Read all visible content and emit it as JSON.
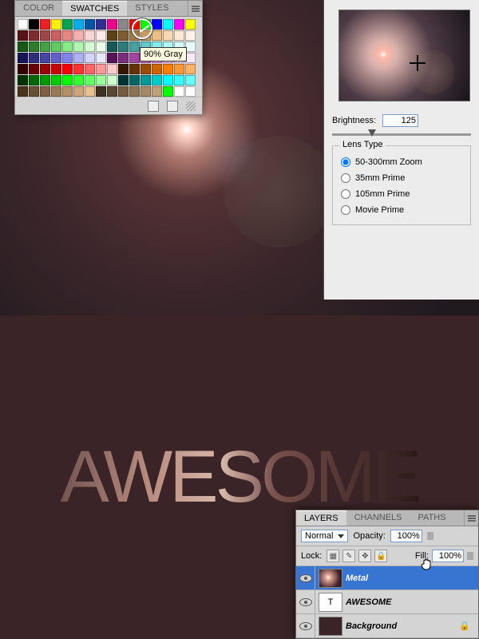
{
  "swatches_panel": {
    "tabs": [
      "COLOR",
      "SWATCHES",
      "STYLES"
    ],
    "active_tab": 1,
    "tooltip": "90% Gray",
    "colors": [
      "#ffffff",
      "#000000",
      "#ed2024",
      "#fff200",
      "#00a551",
      "#00aeef",
      "#0054a6",
      "#2e3092",
      "#ec008c",
      "#898989",
      "#ff0000",
      "#00ff00",
      "#0000ff",
      "#00ffff",
      "#ff00ff",
      "#ffff00",
      "#581414",
      "#7b2e2e",
      "#a04646",
      "#c96161",
      "#ed8484",
      "#f7b0b0",
      "#fcd5d5",
      "#fde9e9",
      "#5b4114",
      "#7e5e2e",
      "#a27c46",
      "#c99c61",
      "#edbd84",
      "#f7d8b0",
      "#fce9d5",
      "#fdf3e9",
      "#145814",
      "#2e7b2e",
      "#46a046",
      "#61c961",
      "#84ed84",
      "#b0f7b0",
      "#d5fcd5",
      "#e9fde9",
      "#145858",
      "#2e7b7b",
      "#46a0a0",
      "#61c9c9",
      "#84eded",
      "#b0f7f7",
      "#d5fcfc",
      "#e9fdfd",
      "#141458",
      "#2e2e7b",
      "#4646a0",
      "#6161c9",
      "#8484ed",
      "#b0b0f7",
      "#d5d5fc",
      "#e9e9fd",
      "#581458",
      "#7b2e7b",
      "#a046a0",
      "#c961c9",
      "#ed84ed",
      "#f7b0f7",
      "#fcd5fc",
      "#fde9fd",
      "#330000",
      "#660000",
      "#990000",
      "#cc0000",
      "#ff0000",
      "#ff3333",
      "#ff6666",
      "#ff9999",
      "#ffcccc",
      "#331900",
      "#663300",
      "#994c00",
      "#cc6600",
      "#ff8000",
      "#ff9933",
      "#ffb366",
      "#003300",
      "#006600",
      "#009900",
      "#00cc00",
      "#00ff00",
      "#33ff33",
      "#66ff66",
      "#99ff99",
      "#ccffcc",
      "#003333",
      "#006666",
      "#009999",
      "#00cccc",
      "#00ffff",
      "#33ffff",
      "#66ffff",
      "#4d3319",
      "#665033",
      "#806040",
      "#997a52",
      "#b38f66",
      "#cca67a",
      "#e6c08f",
      "#403020",
      "#594633",
      "#735c40",
      "#8c7352",
      "#a68966",
      "#bfa07a",
      "#00ff00",
      "#ffffff",
      "#ffffff"
    ]
  },
  "lens_flare": {
    "brightness_label": "Brightness:",
    "brightness_value": "125",
    "lens_type_label": "Lens Type",
    "options": [
      "50-300mm Zoom",
      "35mm Prime",
      "105mm Prime",
      "Movie Prime"
    ],
    "selected": 0
  },
  "artwork_text": "AWESOME",
  "layers_panel": {
    "tabs": [
      "LAYERS",
      "CHANNELS",
      "PATHS"
    ],
    "active_tab": 0,
    "blend_mode": "Normal",
    "opacity_label": "Opacity:",
    "opacity_value": "100%",
    "lock_label": "Lock:",
    "fill_label": "Fill:",
    "fill_value": "100%",
    "layers": [
      {
        "name": "Metal",
        "thumb": "flare",
        "selected": true,
        "locked": false,
        "type": "image"
      },
      {
        "name": "AWESOME",
        "thumb": "text",
        "selected": false,
        "locked": false,
        "type": "text"
      },
      {
        "name": "Background",
        "thumb": "bg",
        "selected": false,
        "locked": true,
        "type": "image"
      }
    ]
  }
}
